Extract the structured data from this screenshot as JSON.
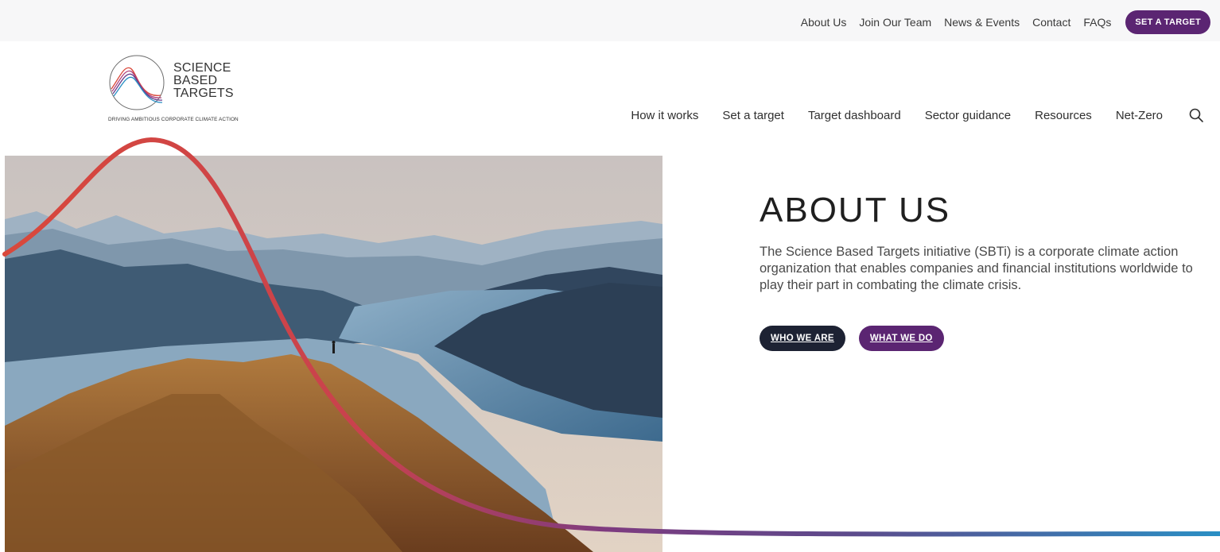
{
  "utility_nav": {
    "links": [
      "About Us",
      "Join Our Team",
      "News & Events",
      "Contact",
      "FAQs"
    ],
    "cta": "SET A TARGET"
  },
  "logo": {
    "words": [
      "SCIENCE",
      "BASED",
      "TARGETS"
    ],
    "tagline": "DRIVING AMBITIOUS CORPORATE CLIMATE ACTION"
  },
  "main_nav": {
    "links": [
      "How it works",
      "Set a target",
      "Target dashboard",
      "Sector guidance",
      "Resources",
      "Net-Zero"
    ],
    "search_icon": "search-icon"
  },
  "hero": {
    "title": "ABOUT US",
    "description": "The Science Based Targets initiative (SBTi) is a corporate climate action organization that enables companies and financial institutions worldwide to play their part in combating the climate crisis.",
    "buttons": [
      "WHO WE ARE",
      "WHAT WE DO"
    ]
  },
  "colors": {
    "brand_purple": "#5b2572",
    "dark_navy": "#1d2233",
    "curve_start": "#d9483b",
    "curve_end": "#2a8fc4"
  }
}
